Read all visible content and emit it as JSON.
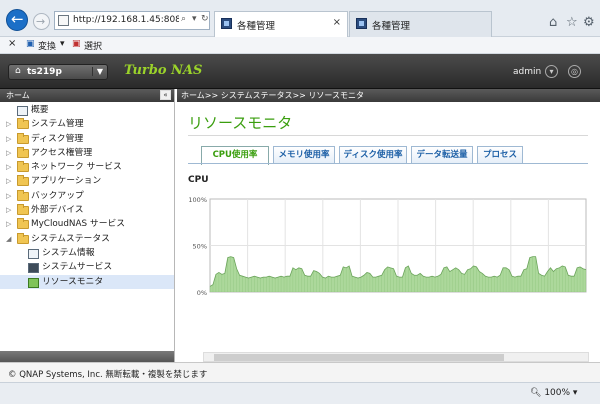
{
  "browser": {
    "address_url": "http://192.168.1.45:8080/c",
    "tabs": [
      {
        "label": "各種管理",
        "active": true
      },
      {
        "label": "各種管理",
        "active": false
      }
    ]
  },
  "command_bar": {
    "close_symbol": "×",
    "convert_label": "変換",
    "select_label": "選択"
  },
  "nas": {
    "device_name": "ts219p",
    "brand": "Turbo NAS",
    "user": "admin"
  },
  "sidebar": {
    "header": "ホーム",
    "items": [
      {
        "label": "概要",
        "level": 0,
        "icon": "overview-icon",
        "expand": ""
      },
      {
        "label": "システム管理",
        "level": 0,
        "icon": "folder-icon",
        "expand": "▷"
      },
      {
        "label": "ディスク管理",
        "level": 0,
        "icon": "folder-icon",
        "expand": "▷"
      },
      {
        "label": "アクセス権管理",
        "level": 0,
        "icon": "folder-icon",
        "expand": "▷"
      },
      {
        "label": "ネットワーク サービス",
        "level": 0,
        "icon": "folder-icon",
        "expand": "▷"
      },
      {
        "label": "アプリケーション",
        "level": 0,
        "icon": "folder-icon",
        "expand": "▷"
      },
      {
        "label": "バックアップ",
        "level": 0,
        "icon": "folder-icon",
        "expand": "▷"
      },
      {
        "label": "外部デバイス",
        "level": 0,
        "icon": "folder-icon",
        "expand": "▷"
      },
      {
        "label": "MyCloudNAS サービス",
        "level": 0,
        "icon": "folder-icon",
        "expand": "▷"
      },
      {
        "label": "システムステータス",
        "level": 0,
        "icon": "folder-open-icon",
        "expand": "◢"
      },
      {
        "label": "システム情報",
        "level": 1,
        "icon": "system-info-icon",
        "expand": ""
      },
      {
        "label": "システムサービス",
        "level": 1,
        "icon": "system-service-icon",
        "expand": ""
      },
      {
        "label": "リソースモニタ",
        "level": 1,
        "icon": "resource-monitor-icon",
        "expand": "",
        "selected": true
      }
    ]
  },
  "breadcrumb": "ホーム>> システムステータス>> リソースモニタ",
  "main": {
    "title": "リソースモニタ",
    "tabs": [
      {
        "label": "CPU使用率",
        "active": true
      },
      {
        "label": "メモリ使用率",
        "active": false
      },
      {
        "label": "ディスク使用率",
        "active": false
      },
      {
        "label": "データ転送量",
        "active": false
      },
      {
        "label": "プロセス",
        "active": false
      }
    ],
    "chart_heading": "CPU"
  },
  "chart_data": {
    "type": "area",
    "title": "CPU",
    "y_ticks": [
      "100%",
      "50%",
      "0%"
    ],
    "ylim": [
      0,
      100
    ],
    "grid": true,
    "color": "#9ed18a",
    "line_color": "#6aa35a",
    "values": [
      6,
      8,
      19,
      21,
      19,
      20,
      37,
      38,
      37,
      25,
      18,
      17,
      16,
      15,
      16,
      17,
      16,
      15,
      16,
      16,
      17,
      16,
      15,
      16,
      17,
      16,
      17,
      17,
      26,
      24,
      26,
      25,
      18,
      17,
      17,
      23,
      22,
      20,
      16,
      15,
      17,
      16,
      16,
      17,
      18,
      27,
      26,
      28,
      17,
      16,
      15,
      16,
      18,
      21,
      20,
      16,
      16,
      17,
      18,
      24,
      27,
      26,
      25,
      17,
      16,
      16,
      26,
      28,
      20,
      18,
      18,
      20,
      17,
      16,
      16,
      17,
      16,
      17,
      19,
      26,
      27,
      22,
      24,
      26,
      24,
      20,
      19,
      24,
      25,
      28,
      27,
      22,
      20,
      17,
      16,
      16,
      17,
      16,
      18,
      26,
      26,
      24,
      17,
      16,
      17,
      17,
      24,
      25,
      37,
      38,
      38,
      20,
      18,
      17,
      22,
      26,
      22,
      25,
      26,
      28,
      27,
      18,
      17,
      17,
      26,
      27,
      25,
      24
    ]
  },
  "footer": "© QNAP Systems, Inc. 無断転載・複製を禁じます",
  "status_bar": {
    "zoom": "100%"
  }
}
